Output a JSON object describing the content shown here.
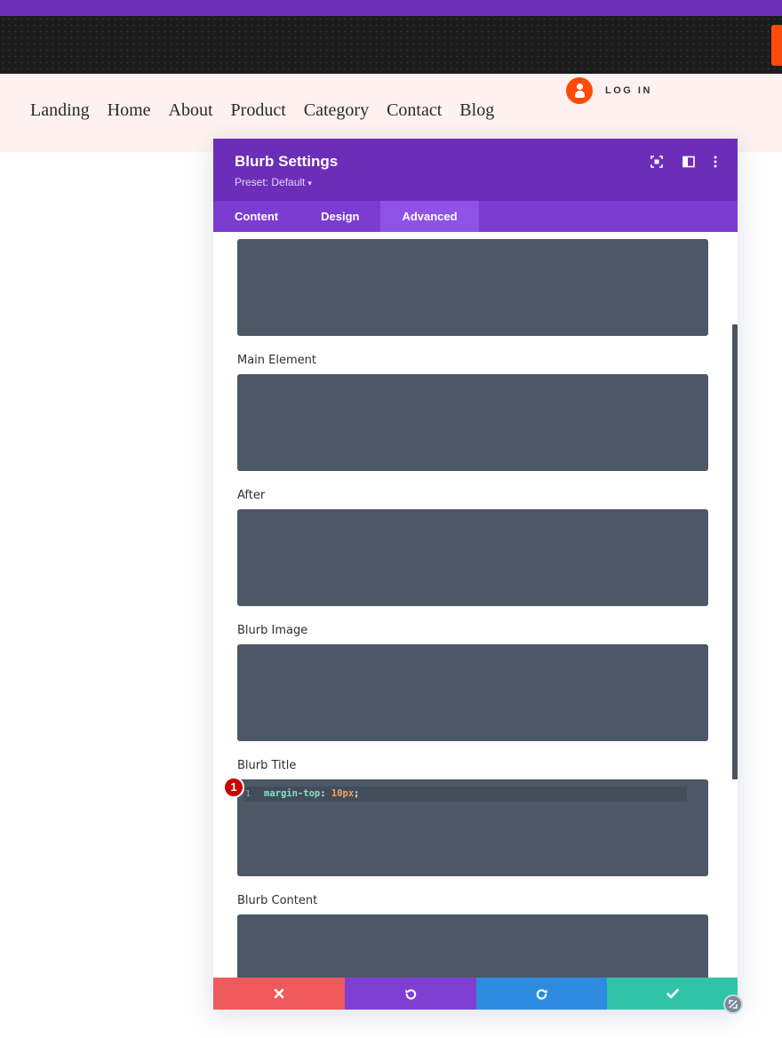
{
  "site": {
    "nav_links": [
      "Landing",
      "Home",
      "About",
      "Product",
      "Category",
      "Contact",
      "Blog"
    ],
    "login_label": "LOG IN",
    "login_icon": "user-icon",
    "accent_orange": "#ff4a0a",
    "accent_purple": "#6d2fb6"
  },
  "modal": {
    "title": "Blurb Settings",
    "preset_label": "Preset: Default",
    "header_icons": [
      "focus-icon",
      "split-view-icon",
      "more-dots-icon"
    ],
    "tabs": [
      {
        "label": "Content",
        "active": false
      },
      {
        "label": "Design",
        "active": false
      },
      {
        "label": "Advanced",
        "active": true
      }
    ],
    "fields": [
      {
        "label": "",
        "code": []
      },
      {
        "label": "Main Element",
        "code": []
      },
      {
        "label": "After",
        "code": []
      },
      {
        "label": "Blurb Image",
        "code": []
      },
      {
        "label": "Blurb Title",
        "code": [
          {
            "line": "1",
            "property": "margin-top",
            "separator": ": ",
            "value": "10px",
            "end": ";"
          }
        ]
      },
      {
        "label": "Blurb Content",
        "code": []
      }
    ],
    "annotation_badge": "1",
    "footer_buttons": [
      {
        "name": "cancel",
        "icon": "close-icon",
        "color": "#ef5a5a"
      },
      {
        "name": "undo",
        "icon": "undo-icon",
        "color": "#7f3fd4"
      },
      {
        "name": "redo",
        "icon": "redo-icon",
        "color": "#2e8ce0"
      },
      {
        "name": "save",
        "icon": "check-icon",
        "color": "#2fc4a8"
      }
    ]
  }
}
